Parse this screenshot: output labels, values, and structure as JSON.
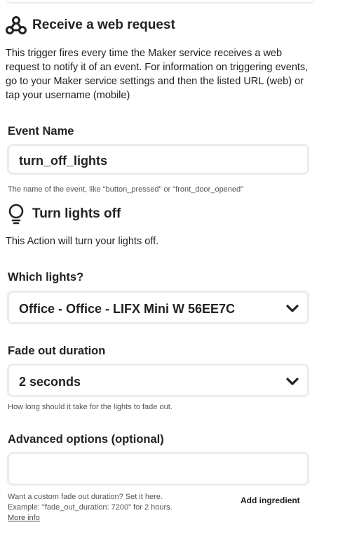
{
  "trigger": {
    "title": "Receive a web request",
    "icon": "webhooks-icon",
    "description": "This trigger fires every time the Maker service receives a web request to notify it of an event. For information on triggering events, go to your Maker service settings and then the listed URL (web) or tap your username (mobile)",
    "event_name": {
      "label": "Event Name",
      "value": "turn_off_lights",
      "help": "The name of the event, like \"button_pressed\" or \"front_door_opened\""
    }
  },
  "action": {
    "title": "Turn lights off",
    "icon": "lightbulb-icon",
    "description": "This Action will turn your lights off.",
    "which_lights": {
      "label": "Which lights?",
      "value": "Office - Office - LIFX Mini W 56EE7C"
    },
    "fade_out": {
      "label": "Fade out duration",
      "value": "2 seconds",
      "help": "How long should it take for the lights to fade out."
    },
    "advanced": {
      "label": "Advanced options (optional)",
      "value": "",
      "help_line1": "Want a custom fade out duration? Set it here.",
      "help_line2": "Example: \"fade_out_duration: 7200\" for 2 hours.",
      "more_info": "More info",
      "add_ingredient": "Add ingredient"
    }
  }
}
